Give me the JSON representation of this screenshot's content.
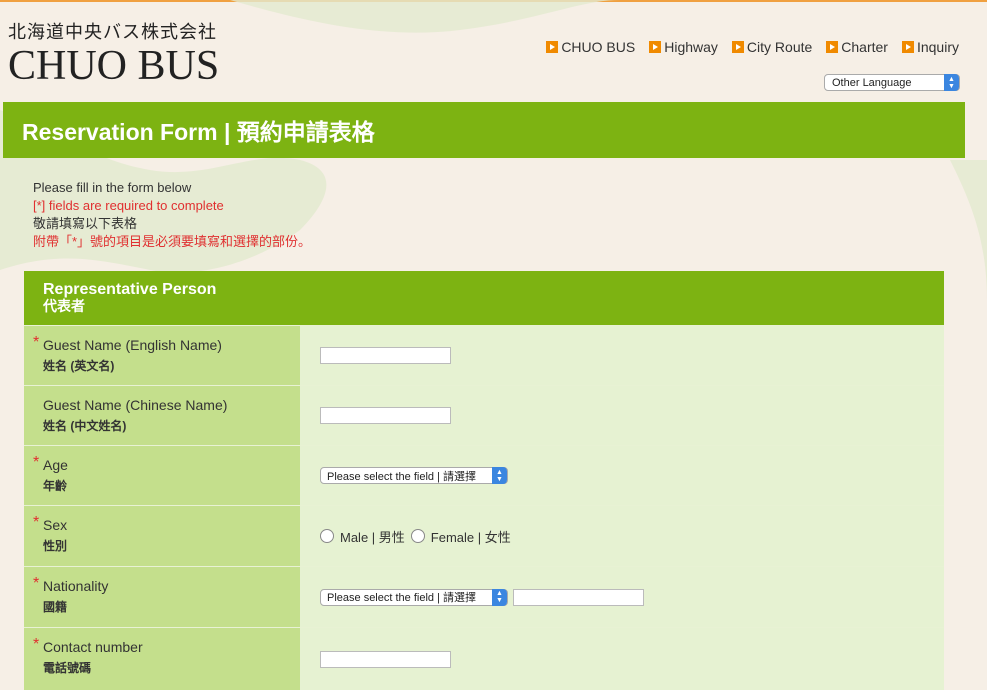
{
  "header": {
    "logo_jp": "北海道中央バス株式会社",
    "logo_en": "CHUO BUS",
    "nav": [
      {
        "label": "CHUO BUS"
      },
      {
        "label": "Highway"
      },
      {
        "label": "City Route"
      },
      {
        "label": "Charter"
      },
      {
        "label": "Inquiry"
      }
    ],
    "language_select": "Other Language"
  },
  "title": "Reservation Form | 預約申請表格",
  "intro": {
    "line1": "Please fill in the form below",
    "line2": "[*] fields are required to complete",
    "line3": "敬請填寫以下表格",
    "line4": "附帶「*」號的項目是必須要填寫和選擇的部份。"
  },
  "section": {
    "title": "Representative Person",
    "subtitle": "代表者"
  },
  "fields": [
    {
      "label_en": "Guest Name (English Name)",
      "label_jp": "姓名 (英文名)",
      "required": "*"
    },
    {
      "label_en": "Guest Name (Chinese Name)",
      "label_jp": "姓名 (中文姓名)",
      "required": ""
    },
    {
      "label_en": "Age",
      "label_jp": "年齡",
      "required": "*",
      "select_value": "Please select the field | 請選擇"
    },
    {
      "label_en": "Sex",
      "label_jp": "性別",
      "required": "*",
      "options": [
        "Male | 男性",
        "Female | 女性"
      ]
    },
    {
      "label_en": "Nationality",
      "label_jp": "國籍",
      "required": "*",
      "select_value": "Please select the field | 請選擇"
    },
    {
      "label_en": "Contact number",
      "label_jp": "電話號碼",
      "required": "*"
    }
  ],
  "colors": {
    "accent_green": "#7db312",
    "label_bg": "#c4df8c",
    "value_bg": "#e6f2d2",
    "nav_arrow": "#f08a00",
    "required_red": "#e03030"
  }
}
